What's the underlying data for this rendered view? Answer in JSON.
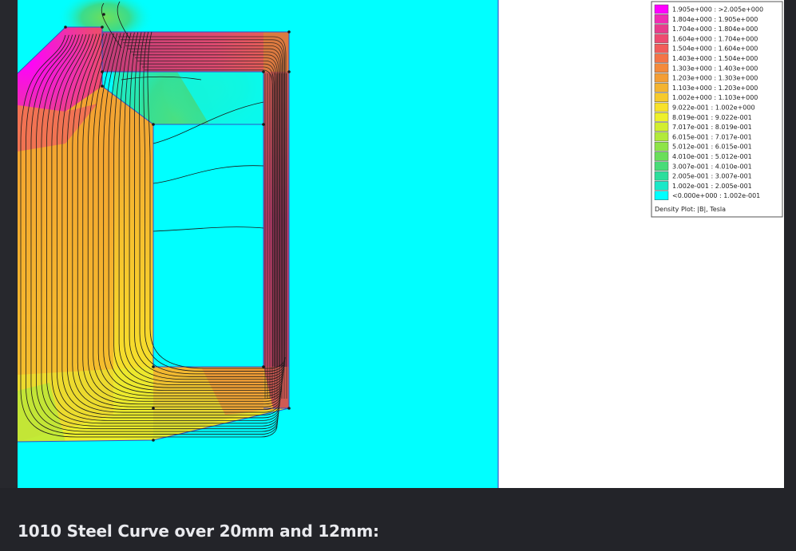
{
  "legend": {
    "title": "Density Plot: |B|, Tesla",
    "entries": [
      {
        "label": "1.905e+000 : >2.005e+000",
        "color": "#ff00ff"
      },
      {
        "label": "1.804e+000 : 1.905e+000",
        "color": "#f02cb4"
      },
      {
        "label": "1.704e+000 : 1.804e+000",
        "color": "#e83c8c"
      },
      {
        "label": "1.604e+000 : 1.704e+000",
        "color": "#ee4a70"
      },
      {
        "label": "1.504e+000 : 1.604e+000",
        "color": "#f25c5a"
      },
      {
        "label": "1.403e+000 : 1.504e+000",
        "color": "#f47446"
      },
      {
        "label": "1.303e+000 : 1.403e+000",
        "color": "#f48a3a"
      },
      {
        "label": "1.203e+000 : 1.303e+000",
        "color": "#f49e34"
      },
      {
        "label": "1.103e+000 : 1.203e+000",
        "color": "#f4b430"
      },
      {
        "label": "1.002e+000 : 1.103e+000",
        "color": "#f6ca2c"
      },
      {
        "label": "9.022e-001 : 1.002e+000",
        "color": "#f8e22a"
      },
      {
        "label": "8.019e-001 : 9.022e-001",
        "color": "#eef02a"
      },
      {
        "label": "7.017e-001 : 8.019e-001",
        "color": "#d2ee30"
      },
      {
        "label": "6.015e-001 : 7.017e-001",
        "color": "#b2ea3a"
      },
      {
        "label": "5.012e-001 : 6.015e-001",
        "color": "#8ee448"
      },
      {
        "label": "4.010e-001 : 5.012e-001",
        "color": "#6ade5a"
      },
      {
        "label": "3.007e-001 : 4.010e-001",
        "color": "#48dc78"
      },
      {
        "label": "2.005e-001 : 3.007e-001",
        "color": "#2cde9c"
      },
      {
        "label": "1.002e-001 : 2.005e-001",
        "color": "#1ae8c8"
      },
      {
        "label": "<0.000e+000 : 1.002e-001",
        "color": "#00ffff"
      }
    ]
  },
  "colors": {
    "page_bg": "#232429",
    "plot_bg": "#00ffff",
    "panel_white": "#ffffff",
    "flux_line": "#1a1a1a",
    "outline": "#2040c0"
  },
  "caption": "1010 Steel Curve over 20mm and 12mm:"
}
